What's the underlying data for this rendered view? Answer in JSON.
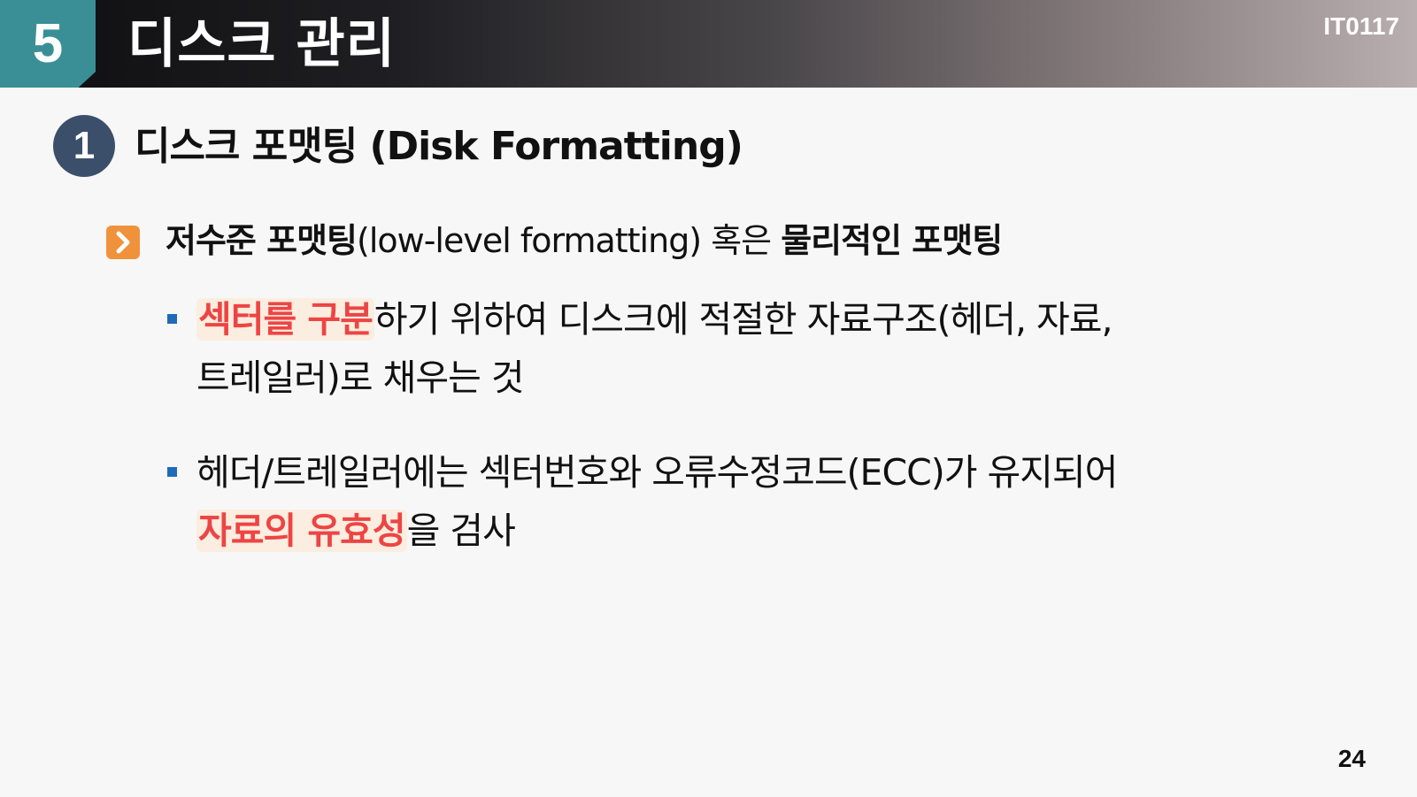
{
  "header": {
    "chapter_number": "5",
    "chapter_title": "디스크 관리",
    "course_code": "IT0117"
  },
  "section": {
    "number": "1",
    "title": "디스크 포맷팅 (Disk Formatting)"
  },
  "point": {
    "bold_a": "저수준 포맷팅",
    "normal": "(low-level formatting) 혹은 ",
    "bold_b": "물리적인 포맷팅"
  },
  "bullets": [
    {
      "line1_highlight": "섹터를 구분",
      "line1_rest": "하기 위하여 디스크에 적절한 자료구조(헤더, 자료,",
      "line2": "트레일러)로 채우는 것"
    },
    {
      "line1": "헤더/트레일러에는 섹터번호와 오류수정코드(ECC)가 유지되어",
      "line2_highlight": "자료의 유효성",
      "line2_rest": "을 검사"
    }
  ],
  "page_number": "24"
}
